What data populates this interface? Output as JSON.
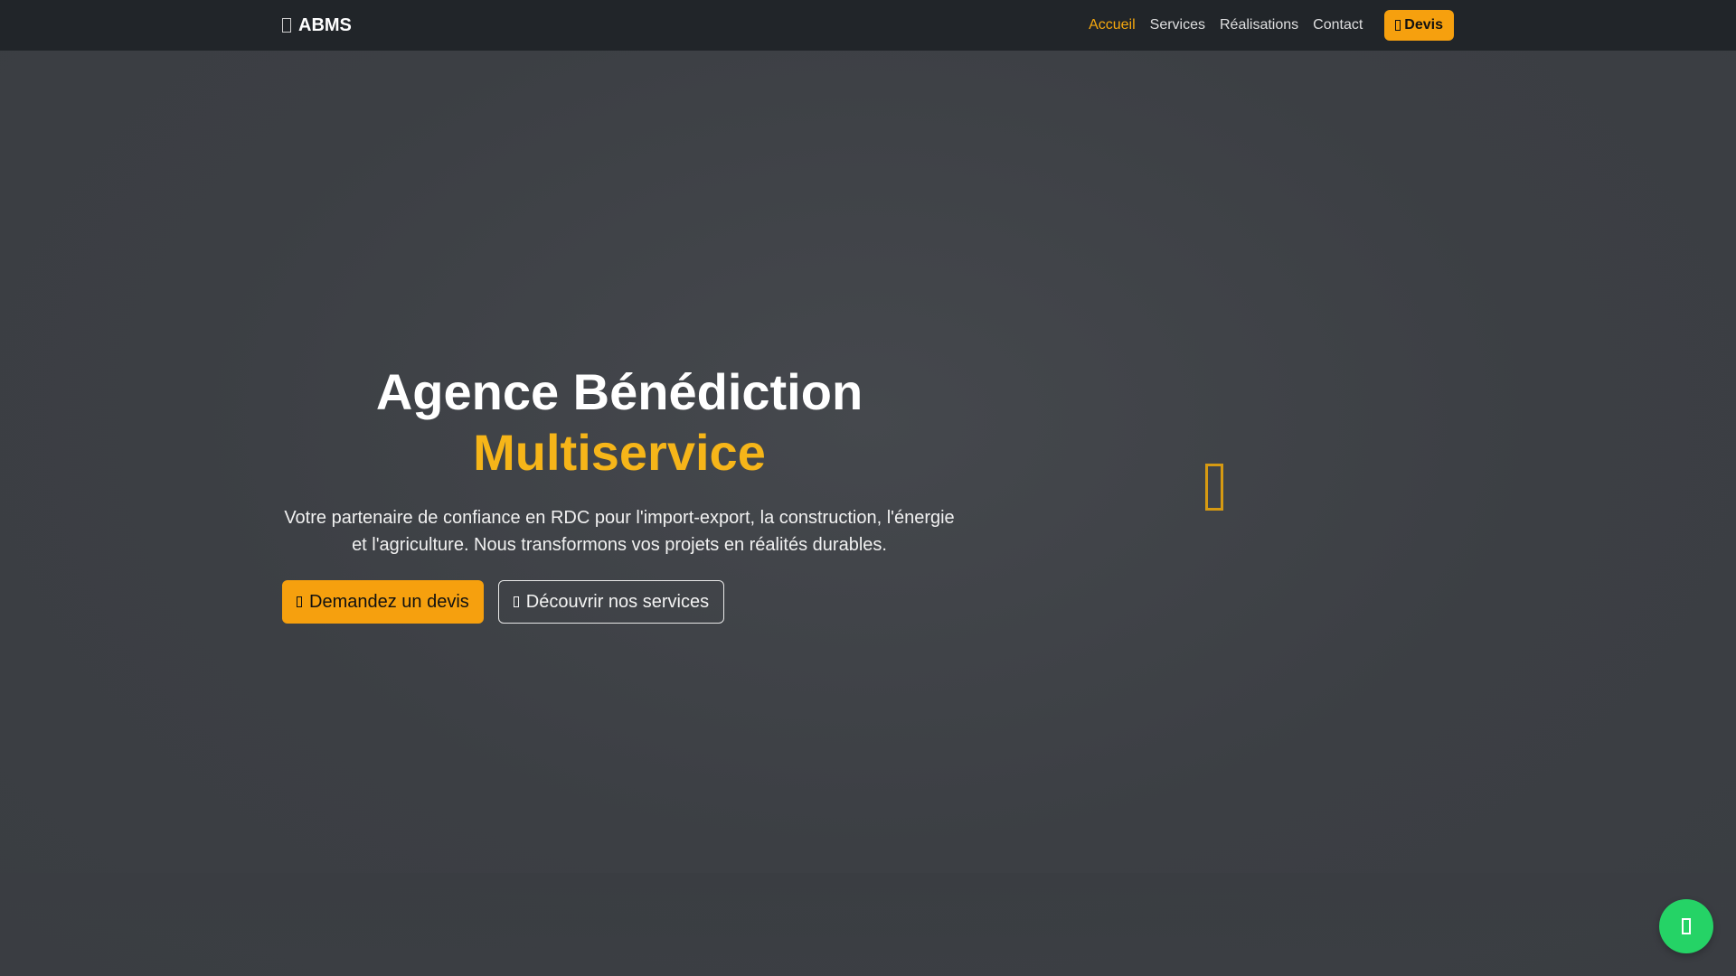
{
  "brand": {
    "name": "ABMS",
    "icon": "building-icon"
  },
  "nav": {
    "links": [
      {
        "label": "Accueil",
        "active": true
      },
      {
        "label": "Services",
        "active": false
      },
      {
        "label": "Réalisations",
        "active": false
      },
      {
        "label": "Contact",
        "active": false
      }
    ],
    "cta": {
      "label": "Devis",
      "icon": "file-icon"
    }
  },
  "hero": {
    "title_line1": "Agence Bénédiction",
    "title_line2": "Multiservice",
    "lead": "Votre partenaire de confiance en RDC pour l'import-export, la construction, l'énergie et l'agriculture. Nous transformons vos projets en réalités durables.",
    "primary_button": {
      "label": "Demandez un devis",
      "icon": "send-icon"
    },
    "secondary_button": {
      "label": "Découvrir nos services",
      "icon": "arrow-down-icon"
    },
    "decoration_icon": "large-symbol-icon"
  },
  "floating": {
    "whatsapp_icon": "whatsapp-icon"
  },
  "colors": {
    "navbar_bg": "#212529",
    "accent": "#f6a00e",
    "accent_text": "#f6b519",
    "hero_bg": "#3e4146",
    "whatsapp": "#25d366"
  }
}
